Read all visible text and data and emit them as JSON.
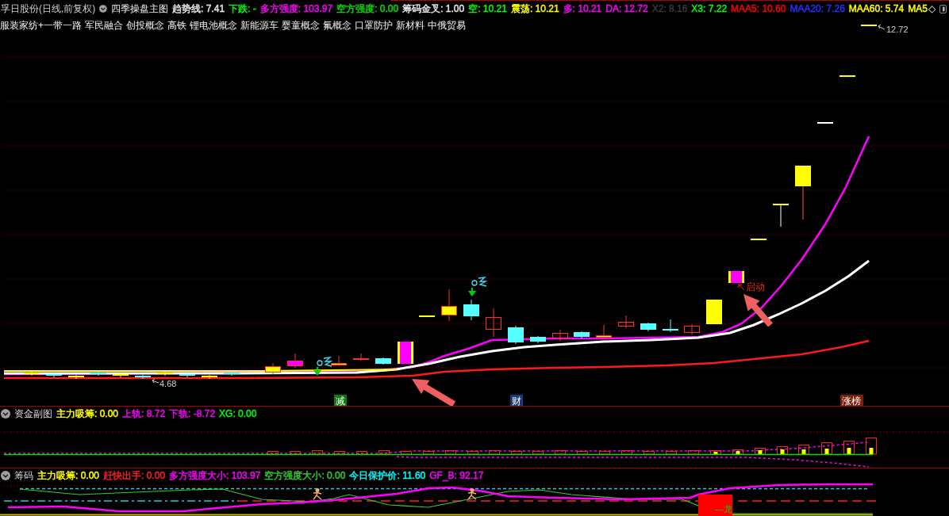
{
  "header": {
    "stock_name": "孚日股份(日线,前复权)",
    "indicator_name": "四季操盘主图",
    "readings": [
      {
        "text": "趋势线: 7.41",
        "color": "#e8e8e8"
      },
      {
        "text": "下跌: -",
        "color": "#00ff00"
      },
      {
        "text": "多方强度: 103.97",
        "color": "#ff00ff"
      },
      {
        "text": "空方强度: 0.00",
        "color": "#00e000"
      },
      {
        "text": "筹码金叉: 1.00",
        "color": "#e8e8e8"
      },
      {
        "text": "空: 10.21",
        "color": "#00ff00"
      },
      {
        "text": "震荡: 10.21",
        "color": "#ffff00"
      },
      {
        "text": "多: 10.21",
        "color": "#ff00ff"
      },
      {
        "text": "DA: 12.72",
        "color": "#ff00ff"
      },
      {
        "text": "X2: 8.16",
        "color": "#3a3a3a"
      },
      {
        "text": "X3: 7.22",
        "color": "#00ff00"
      },
      {
        "text": "MAA5: 10.60",
        "color": "#ff0000"
      },
      {
        "text": "MAA20: 7.26",
        "color": "#2233ff"
      },
      {
        "text": "MAA60: 5.74",
        "color": "#ffff00"
      },
      {
        "text": "MA5",
        "color": "#ffff00"
      }
    ],
    "more_glyph": "◇"
  },
  "concepts": [
    "服装家纺+一带一路",
    "军民融合",
    "创投概念",
    "高铁",
    "锂电池概念",
    "新能源车",
    "婴童概念",
    "氟概念",
    "口罩防护",
    "新材料",
    "中俄贸易"
  ],
  "main_chart": {
    "high_label": "12.72",
    "low_label": "4.68",
    "signal_badges": [
      {
        "text": "减",
        "color": "#0f7a0f"
      },
      {
        "text": "财",
        "color": "#173a7a"
      },
      {
        "text": "涨榜",
        "color": "#7a200c"
      }
    ],
    "annotation": "启动"
  },
  "fund_panel": {
    "title": "资金副图",
    "readings": [
      {
        "text": "主力吸筹: 0.00",
        "color": "#ffff00"
      },
      {
        "text": "上轨: 8.72",
        "color": "#ff00ff"
      },
      {
        "text": "下轨: -8.72",
        "color": "#ff00ff"
      },
      {
        "text": "XG: 0.00",
        "color": "#00ff00"
      }
    ]
  },
  "chip_panel": {
    "title": "筹码",
    "readings": [
      {
        "text": "主力吸筹: 0.00",
        "color": "#ffff00"
      },
      {
        "text": "赶快出手: 0.00",
        "color": "#ff2020"
      },
      {
        "text": "多方强度大小: 103.97",
        "color": "#ff00ff"
      },
      {
        "text": "空方强度大小: 0.00",
        "color": "#33cc33"
      },
      {
        "text": "今日保护价: 11.60",
        "color": "#00ffff"
      },
      {
        "text": "GF_B: 92.17",
        "color": "#ff00ff"
      }
    ],
    "signal_label": "---龙"
  }
}
